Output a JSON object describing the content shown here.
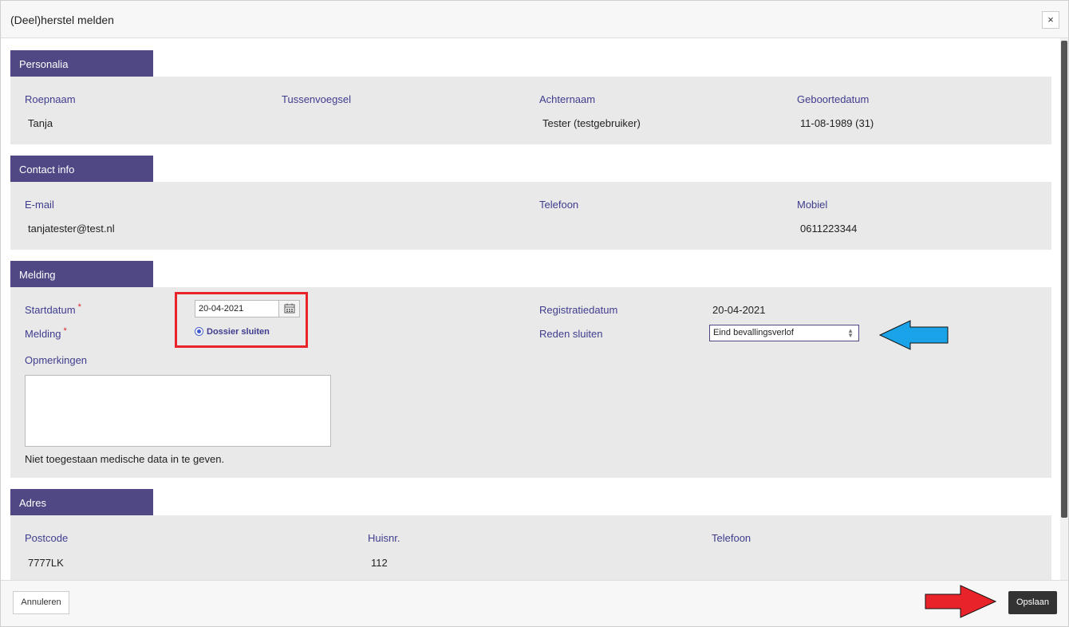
{
  "dialog": {
    "title": "(Deel)herstel melden",
    "close_label": "×"
  },
  "personalia": {
    "header": "Personalia",
    "roepnaam_label": "Roepnaam",
    "roepnaam": "Tanja",
    "tussenvoegsel_label": "Tussenvoegsel",
    "tussenvoegsel": "",
    "achternaam_label": "Achternaam",
    "achternaam": "Tester (testgebruiker)",
    "geboortedatum_label": "Geboortedatum",
    "geboortedatum": "11-08-1989 (31)"
  },
  "contact": {
    "header": "Contact info",
    "email_label": "E-mail",
    "email": "tanjatester@test.nl",
    "telefoon_label": "Telefoon",
    "telefoon": "",
    "mobiel_label": "Mobiel",
    "mobiel": "0611223344"
  },
  "melding": {
    "header": "Melding",
    "startdatum_label": "Startdatum",
    "startdatum": "20-04-2021",
    "melding_label": "Melding",
    "melding_option": "Dossier sluiten",
    "registratiedatum_label": "Registratiedatum",
    "registratiedatum": "20-04-2021",
    "reden_label": "Reden sluiten",
    "reden": "Eind bevallingsverlof",
    "opmerkingen_label": "Opmerkingen",
    "opmerkingen": "",
    "hint": "Niet toegestaan medische data in te geven.",
    "required_mark": "*"
  },
  "adres": {
    "header": "Adres",
    "postcode_label": "Postcode",
    "postcode": "7777LK",
    "huisnr_label": "Huisnr.",
    "huisnr": "112",
    "telefoon_label": "Telefoon",
    "telefoon": ""
  },
  "footer": {
    "cancel_label": "Annuleren",
    "save_label": "Opslaan"
  },
  "icons": {
    "calendar": "calendar-icon",
    "close": "close-icon",
    "select_arrows": "sort-arrows-icon"
  },
  "colors": {
    "section_header": "#4f4885",
    "label": "#3f3d8e",
    "highlight_box": "#e8242a",
    "arrow_blue": "#1aa3e8",
    "arrow_red": "#e8242a",
    "save_button": "#333333"
  }
}
